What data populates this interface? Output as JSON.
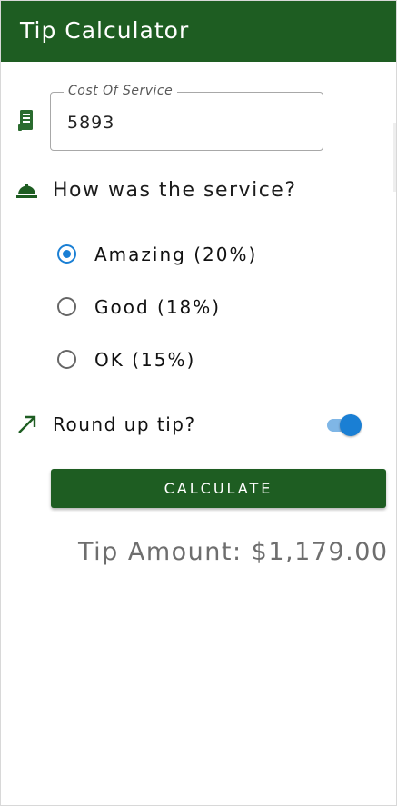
{
  "app_bar": {
    "title": "Tip Calculator",
    "color": "#1e5d22"
  },
  "cost_field": {
    "label": "Cost Of Service",
    "value": "5893",
    "icon": "receipt-icon"
  },
  "service_question": {
    "text": "How was the service?",
    "icon": "room-service-bell-icon"
  },
  "service_options": [
    {
      "label": "Amazing (20%)",
      "checked": true
    },
    {
      "label": "Good (18%)",
      "checked": false
    },
    {
      "label": "OK (15%)",
      "checked": false
    }
  ],
  "round_up": {
    "label": "Round up tip?",
    "icon": "trending-up-icon",
    "enabled": true
  },
  "calculate_button": {
    "label": "CALCULATE"
  },
  "result": {
    "text": "Tip Amount: $1,179.00"
  },
  "colors": {
    "primary": "#1e5d22",
    "accent": "#1a7fd4"
  }
}
